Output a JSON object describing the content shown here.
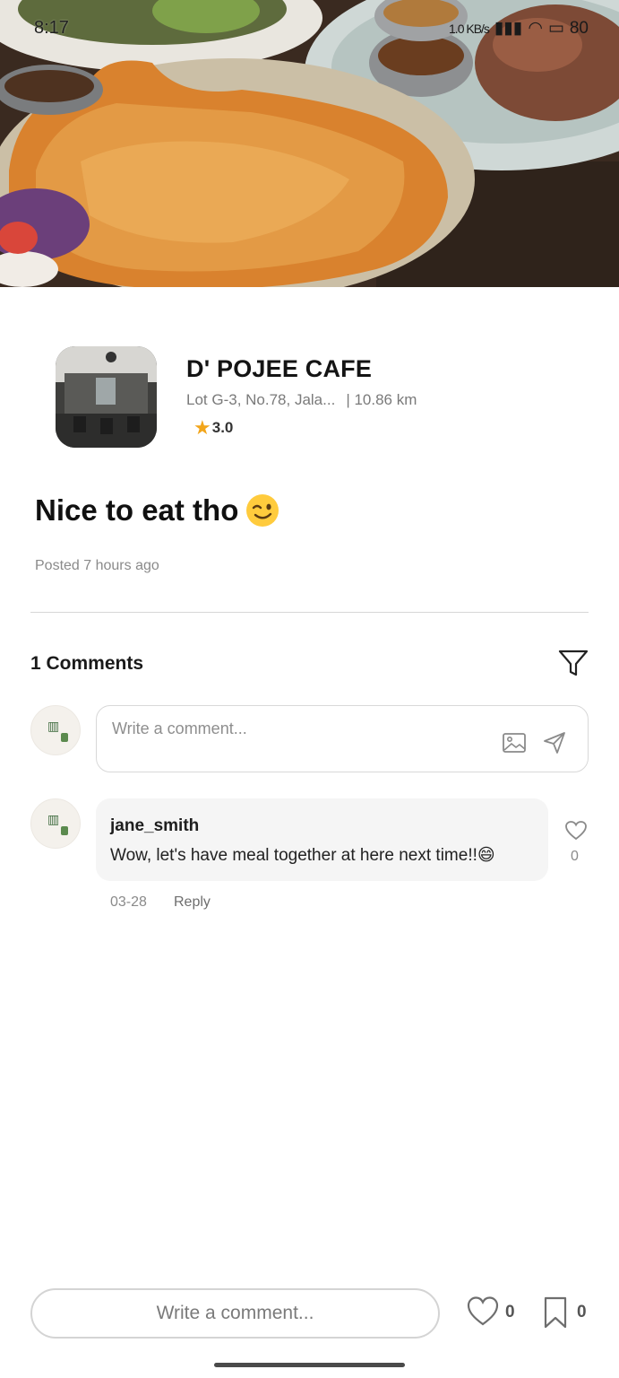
{
  "status_bar": {
    "time": "8:17",
    "network_speed": "1.0 KB/s",
    "battery": "80"
  },
  "hero": {
    "image_alt": "fried chicken cutlet plate"
  },
  "cafe": {
    "name": "D' POJEE CAFE",
    "address": "Lot G-3, No.78, Jala...",
    "distance": "| 10.86 km",
    "rating": "3.0"
  },
  "post": {
    "title": "Nice to eat tho",
    "meta": "Posted 7 hours ago"
  },
  "comments": {
    "heading": "1 Comments",
    "input_placeholder": "Write a comment...",
    "items": [
      {
        "user": "jane_smith",
        "text": "Wow, let's have meal together at here next time!!😄",
        "likes": "0",
        "date": "03-28",
        "reply_label": "Reply"
      }
    ]
  },
  "bottom_bar": {
    "input_placeholder": "Write a comment...",
    "like_count": "0",
    "save_count": "0"
  },
  "colors": {
    "star": "#f2a51a",
    "bubble": "#f5f5f5",
    "border": "#d8d8d8"
  }
}
